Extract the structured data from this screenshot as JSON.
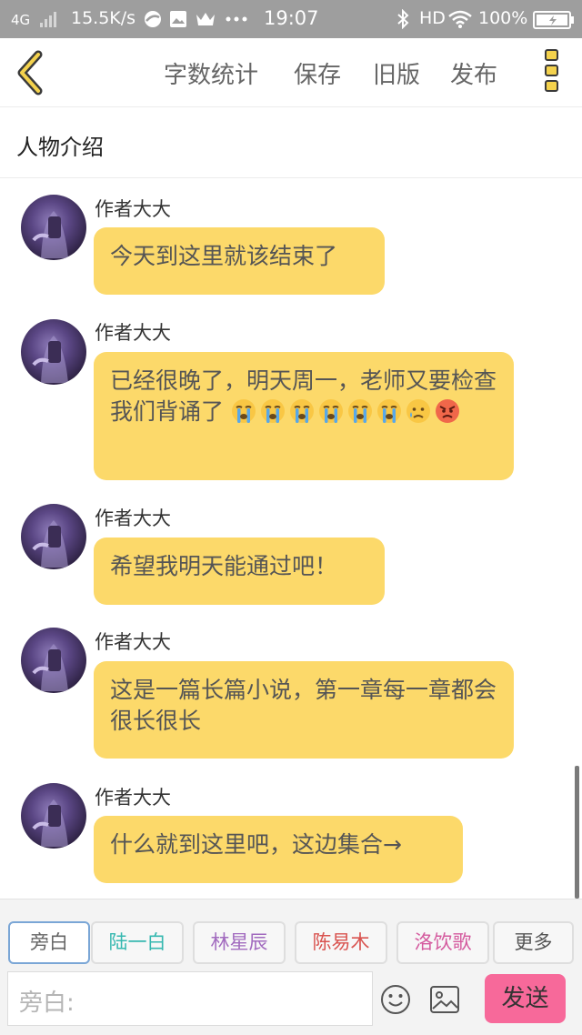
{
  "status_bar": {
    "network": "4G",
    "speed": "15.5K/s",
    "time": "19:07",
    "hd": "HD",
    "battery": "100%",
    "icons": [
      "signal-icon",
      "shield-app-icon",
      "image-notification-icon",
      "crown-icon",
      "ellipsis-icon",
      "bluetooth-icon",
      "wifi-icon",
      "battery-icon"
    ]
  },
  "toolbar": {
    "back_icon": "chevron-left-icon",
    "word_count": "字数统计",
    "save": "保存",
    "old_version": "旧版",
    "publish": "发布",
    "more_icon": "more-vertical-icon",
    "accent_color": "#f4d24d"
  },
  "section": {
    "title": "人物介绍"
  },
  "messages": [
    {
      "author": "作者大大",
      "text": "今天到这里就该结束了",
      "emojis": []
    },
    {
      "author": "作者大大",
      "text": "已经很晚了，明天周一，老师又要检查我们背诵了",
      "emojis": [
        "crying-face-icon",
        "crying-face-icon",
        "crying-face-icon",
        "crying-face-icon",
        "crying-face-icon",
        "crying-face-icon",
        "sad-tear-face-icon",
        "angry-face-icon"
      ]
    },
    {
      "author": "作者大大",
      "text": "希望我明天能通过吧！",
      "emojis": []
    },
    {
      "author": "作者大大",
      "text": "这是一篇长篇小说，第一章每一章都会很长很长",
      "emojis": []
    },
    {
      "author": "作者大大",
      "text": "什么就到这里吧，这边集合→",
      "emojis": []
    }
  ],
  "bubble_color": "#fcd96a",
  "characters": [
    {
      "label": "旁白",
      "color": "#666666",
      "selected": true
    },
    {
      "label": "陆一白",
      "color": "#36b8b0",
      "selected": false
    },
    {
      "label": "林星辰",
      "color": "#a26bbf",
      "selected": false
    },
    {
      "label": "陈易木",
      "color": "#d9534f",
      "selected": false
    },
    {
      "label": "洛饮歌",
      "color": "#d45a9e",
      "selected": false
    },
    {
      "label": "更多",
      "color": "#555555",
      "selected": false
    }
  ],
  "composer": {
    "placeholder": "旁白:",
    "emoji_icon": "smiley-icon",
    "image_icon": "image-icon",
    "send": "发送",
    "send_color": "#f7699a"
  }
}
